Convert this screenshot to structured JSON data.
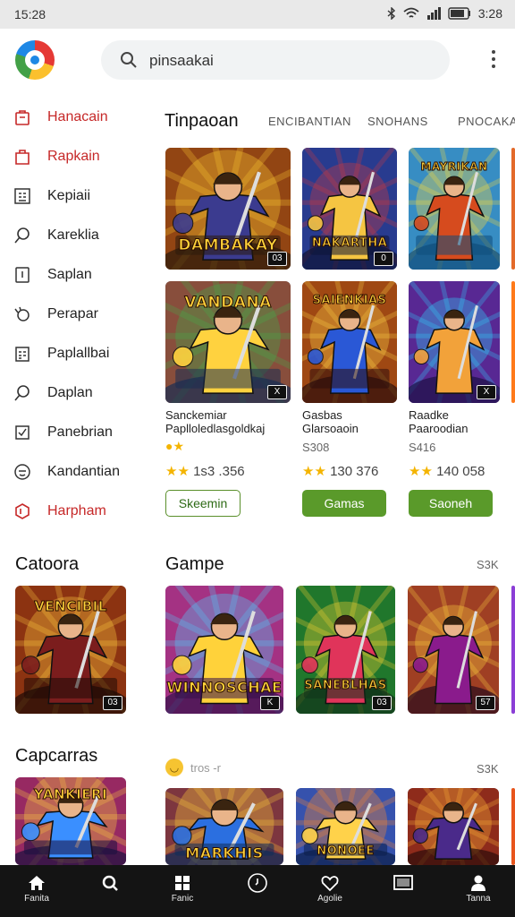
{
  "status": {
    "time": "15:28",
    "battery": "3:28"
  },
  "search": {
    "value": "pinsaakai"
  },
  "sidebar": {
    "items": [
      {
        "label": "Hanacain",
        "icon": "bag-icon",
        "active": true
      },
      {
        "label": "Rapkain",
        "icon": "shopping-bag-icon",
        "active": true
      },
      {
        "label": "Kepiaii",
        "icon": "grid-icon",
        "active": false
      },
      {
        "label": "Kareklia",
        "icon": "search-icon",
        "active": false
      },
      {
        "label": "Saplan",
        "icon": "tablet-icon",
        "active": false
      },
      {
        "label": "Perapar",
        "icon": "hand-icon",
        "active": false
      },
      {
        "label": "Paplallbai",
        "icon": "calendar-icon",
        "active": false
      },
      {
        "label": "Daplan",
        "icon": "search-icon",
        "active": false
      },
      {
        "label": "Panebrian",
        "icon": "check-box-icon",
        "active": false
      },
      {
        "label": "Kandantian",
        "icon": "smile-icon",
        "active": false
      },
      {
        "label": "Harpham",
        "icon": "shield-icon",
        "active": true
      }
    ]
  },
  "top_section": {
    "title": "Tinpaoan",
    "tabs": [
      "ENCIBANTIAN",
      "SNOHANS",
      "PNOCAKAR"
    ]
  },
  "featured": [
    {
      "title": "DAMBAKAY",
      "badge": "03"
    },
    {
      "title": "NAKARTHA",
      "badge": "0"
    },
    {
      "title": "MAYRIKAN",
      "badge": ""
    }
  ],
  "featured_row2": [
    {
      "banner": "VANDANA",
      "badge": "X",
      "title": "Sanckemiar",
      "subtitle": "Paplloledlasgoldkaj",
      "price": "",
      "rating": "1s3 .356",
      "button": "Skeemin",
      "button_style": "outline"
    },
    {
      "banner": "SAIENKIAS",
      "badge": "",
      "title": "Gasbas",
      "subtitle": "Glarsoaoin",
      "price": "S308",
      "rating": "130 376",
      "button": "Gamas",
      "button_style": "fill"
    },
    {
      "banner": "",
      "badge": "X",
      "title": "Raadke",
      "subtitle": "Paaroodian",
      "price": "S416",
      "rating": "140 058",
      "button": "Saoneh",
      "button_style": "fill"
    }
  ],
  "left_section_1": {
    "title": "Catoora"
  },
  "left_card_1": {
    "banner": "VENCIBIL",
    "badge": "03"
  },
  "mid_section": {
    "title": "Gampe",
    "more": "S3K"
  },
  "games": [
    {
      "banner": "WINNOSCHAE",
      "badge": "K"
    },
    {
      "banner": "SANEBLHAS",
      "badge": "03"
    },
    {
      "banner": "",
      "badge": "57"
    }
  ],
  "left_section_2": {
    "title": "Capcarras"
  },
  "left_card_2": {
    "banner": "YANKIERI"
  },
  "bottom_section": {
    "emoji_label": "tros -r",
    "more": "S3K"
  },
  "bottom_games": [
    {
      "banner": "MARKHIS"
    },
    {
      "banner": "NONOEE"
    },
    {
      "banner": ""
    }
  ],
  "bottom_nav": [
    {
      "label": "Fanita",
      "icon": "home-icon"
    },
    {
      "label": "",
      "icon": "search-icon"
    },
    {
      "label": "Fanic",
      "icon": "grid-icon"
    },
    {
      "label": "",
      "icon": "clock-icon"
    },
    {
      "label": "Agolie",
      "icon": "heart-icon"
    },
    {
      "label": "",
      "icon": "tv-icon"
    },
    {
      "label": "Tanna",
      "icon": "person-icon"
    }
  ]
}
